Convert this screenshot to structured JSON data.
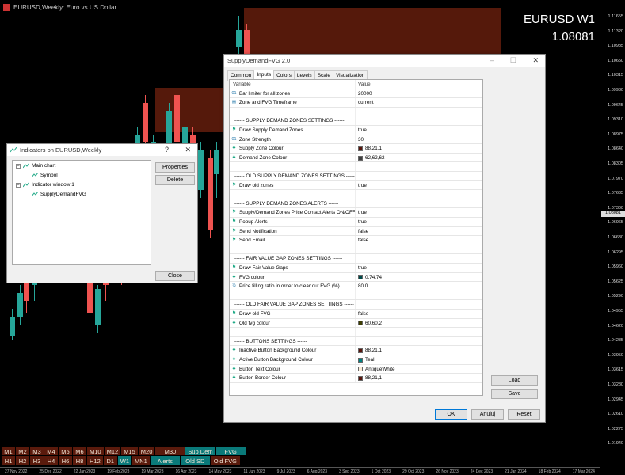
{
  "chart": {
    "window_title": "EURUSD,Weekly: Euro vs US Dollar",
    "symbol": "EURUSD W1",
    "price": "1.08081",
    "current_price_label": "1.08081",
    "price_labels": [
      "1.11655",
      "1.11320",
      "1.10985",
      "1.10650",
      "1.10315",
      "1.09980",
      "1.09645",
      "1.09310",
      "1.08975",
      "1.08640",
      "1.08305",
      "1.07970",
      "1.07635",
      "1.07300",
      "1.06965",
      "1.06630",
      "1.06295",
      "1.05960",
      "1.05625",
      "1.05290",
      "1.04955",
      "1.04620",
      "1.04285",
      "1.03950",
      "1.03615",
      "1.03280",
      "1.02945",
      "1.02610",
      "1.02275",
      "1.01940"
    ],
    "time_labels": [
      "27 Nov 2022",
      "25 Dec 2022",
      "22 Jan 2023",
      "19 Feb 2023",
      "19 Mar 2023",
      "16 Apr 2023",
      "14 May 2023",
      "11 Jun 2023",
      "9 Jul 2023",
      "6 Aug 2023",
      "3 Sep 2023",
      "1 Oct 2023",
      "29 Oct 2023",
      "26 Nov 2023",
      "24 Dec 2023",
      "21 Jan 2024",
      "18 Feb 2024",
      "17 Mar 2024"
    ],
    "colors": {
      "bull": "#26a69a",
      "bear": "#ef5350",
      "supply_zone": "#58150c",
      "background": "#000000"
    }
  },
  "tf_buttons": {
    "row1": [
      {
        "label": "M1",
        "style": "red"
      },
      {
        "label": "M2",
        "style": "red"
      },
      {
        "label": "M3",
        "style": "red"
      },
      {
        "label": "M4",
        "style": "red"
      },
      {
        "label": "M5",
        "style": "red"
      },
      {
        "label": "M6",
        "style": "red"
      },
      {
        "label": "M10",
        "style": "red"
      },
      {
        "label": "M12",
        "style": "red"
      },
      {
        "label": "M15",
        "style": "red"
      },
      {
        "label": "M20",
        "style": "red"
      },
      {
        "label": "M30",
        "style": "red",
        "wide": true
      },
      {
        "label": "Sup Dem",
        "style": "teal",
        "wide": true
      },
      {
        "label": "FVG",
        "style": "teal",
        "wide": true
      }
    ],
    "row2": [
      {
        "label": "H1",
        "style": "red"
      },
      {
        "label": "H2",
        "style": "red"
      },
      {
        "label": "H3",
        "style": "red"
      },
      {
        "label": "H4",
        "style": "red"
      },
      {
        "label": "H6",
        "style": "red"
      },
      {
        "label": "H8",
        "style": "red"
      },
      {
        "label": "H12",
        "style": "red"
      },
      {
        "label": "D1",
        "style": "red"
      },
      {
        "label": "W1",
        "style": "teal"
      },
      {
        "label": "MN1",
        "style": "red"
      },
      {
        "label": "Alerts",
        "style": "teal",
        "wide": true
      },
      {
        "label": "Old SD",
        "style": "teal",
        "wide": true
      },
      {
        "label": "Old FVG",
        "style": "red",
        "wide": true
      }
    ]
  },
  "indicators_dialog": {
    "title": "Indicators on EURUSD,Weekly",
    "help": "?",
    "close_x": "✕",
    "tree": [
      {
        "label": "Main chart",
        "level": 0
      },
      {
        "label": "Symbol",
        "level": 1
      },
      {
        "label": "Indicator window 1",
        "level": 0
      },
      {
        "label": "SupplyDemandFVG",
        "level": 1
      }
    ],
    "buttons": {
      "properties": "Properties",
      "delete": "Delete",
      "close": "Close"
    }
  },
  "settings_dialog": {
    "title": "SupplyDemandFVG 2.0",
    "min": "–",
    "max": "☐",
    "close_x": "✕",
    "tabs": [
      "Common",
      "Inputs",
      "Colors",
      "Levels",
      "Scale",
      "Visualization"
    ],
    "active_tab": "Inputs",
    "columns": {
      "variable": "Variable",
      "value": "Value"
    },
    "rows": [
      {
        "icon": "01",
        "name": "Bar limiter for all zones",
        "value": "20000"
      },
      {
        "icon": "db",
        "name": "Zone and FVG Timeframe",
        "value": "current"
      },
      {
        "icon": "",
        "name": "",
        "value": ""
      },
      {
        "icon": "",
        "name": "------  SUPPLY DEMAND ZONES SETTINGS  ------",
        "value": "",
        "header": true
      },
      {
        "icon": "flag",
        "name": "Draw Supply Demand Zones",
        "value": "true"
      },
      {
        "icon": "01",
        "name": "Zone Strength",
        "value": "30"
      },
      {
        "icon": "pal",
        "name": "Supply Zone Colour",
        "value": "88,21,1",
        "swatch": "#58150c"
      },
      {
        "icon": "pal",
        "name": "Demand Zone Colour",
        "value": "62,62,62",
        "swatch": "#3e3e3e"
      },
      {
        "icon": "",
        "name": "",
        "value": ""
      },
      {
        "icon": "",
        "name": "------  OLD SUPPLY DEMAND ZONES SETTINGS  ------",
        "value": "",
        "header": true
      },
      {
        "icon": "flag",
        "name": "Draw old zones",
        "value": "true"
      },
      {
        "icon": "",
        "name": "",
        "value": ""
      },
      {
        "icon": "",
        "name": "------  SUPPLY DEMAND ZONES ALERTS  ------",
        "value": "",
        "header": true
      },
      {
        "icon": "flag",
        "name": "Supply/Demand Zones Price Contact Alerts ON/OFF",
        "value": "true"
      },
      {
        "icon": "flag",
        "name": "Popup Alerts",
        "value": "true"
      },
      {
        "icon": "flag",
        "name": "Send Notification",
        "value": "false"
      },
      {
        "icon": "flag",
        "name": "Send Email",
        "value": "false"
      },
      {
        "icon": "",
        "name": "",
        "value": ""
      },
      {
        "icon": "",
        "name": "------  FAIR VALUE GAP ZONES SETTINGS  ------",
        "value": "",
        "header": true
      },
      {
        "icon": "flag",
        "name": "Draw Fair Value Gaps",
        "value": "true"
      },
      {
        "icon": "pal",
        "name": "FVG colour",
        "value": "0,74,74",
        "swatch": "#004a4a"
      },
      {
        "icon": "½",
        "name": "Price filling ratio in order to clear out FVG (%)",
        "value": "80.0"
      },
      {
        "icon": "",
        "name": "",
        "value": ""
      },
      {
        "icon": "",
        "name": "------  OLD FAIR VALUE GAP ZONES SETTINGS  ------",
        "value": "",
        "header": true
      },
      {
        "icon": "flag",
        "name": "Draw old FVG",
        "value": "false"
      },
      {
        "icon": "pal",
        "name": "Old fvg colour",
        "value": "60,60,2",
        "swatch": "#3c3c02"
      },
      {
        "icon": "",
        "name": "",
        "value": ""
      },
      {
        "icon": "",
        "name": "------  BUTTONS SETTINGS  ------",
        "value": "",
        "header": true
      },
      {
        "icon": "pal",
        "name": "Inactive Button Background Colour",
        "value": "88,21,1",
        "swatch": "#58150c"
      },
      {
        "icon": "pal",
        "name": "Active Button Background Colour",
        "value": "Teal",
        "swatch": "#008080"
      },
      {
        "icon": "pal",
        "name": "Button Text Colour",
        "value": "AntiqueWhite",
        "swatch": "#faebd7"
      },
      {
        "icon": "pal",
        "name": "Button Border Colour",
        "value": "88,21,1",
        "swatch": "#58150c"
      }
    ],
    "buttons": {
      "load": "Load",
      "save": "Save",
      "ok": "OK",
      "cancel": "Anuluj",
      "reset": "Reset"
    }
  }
}
